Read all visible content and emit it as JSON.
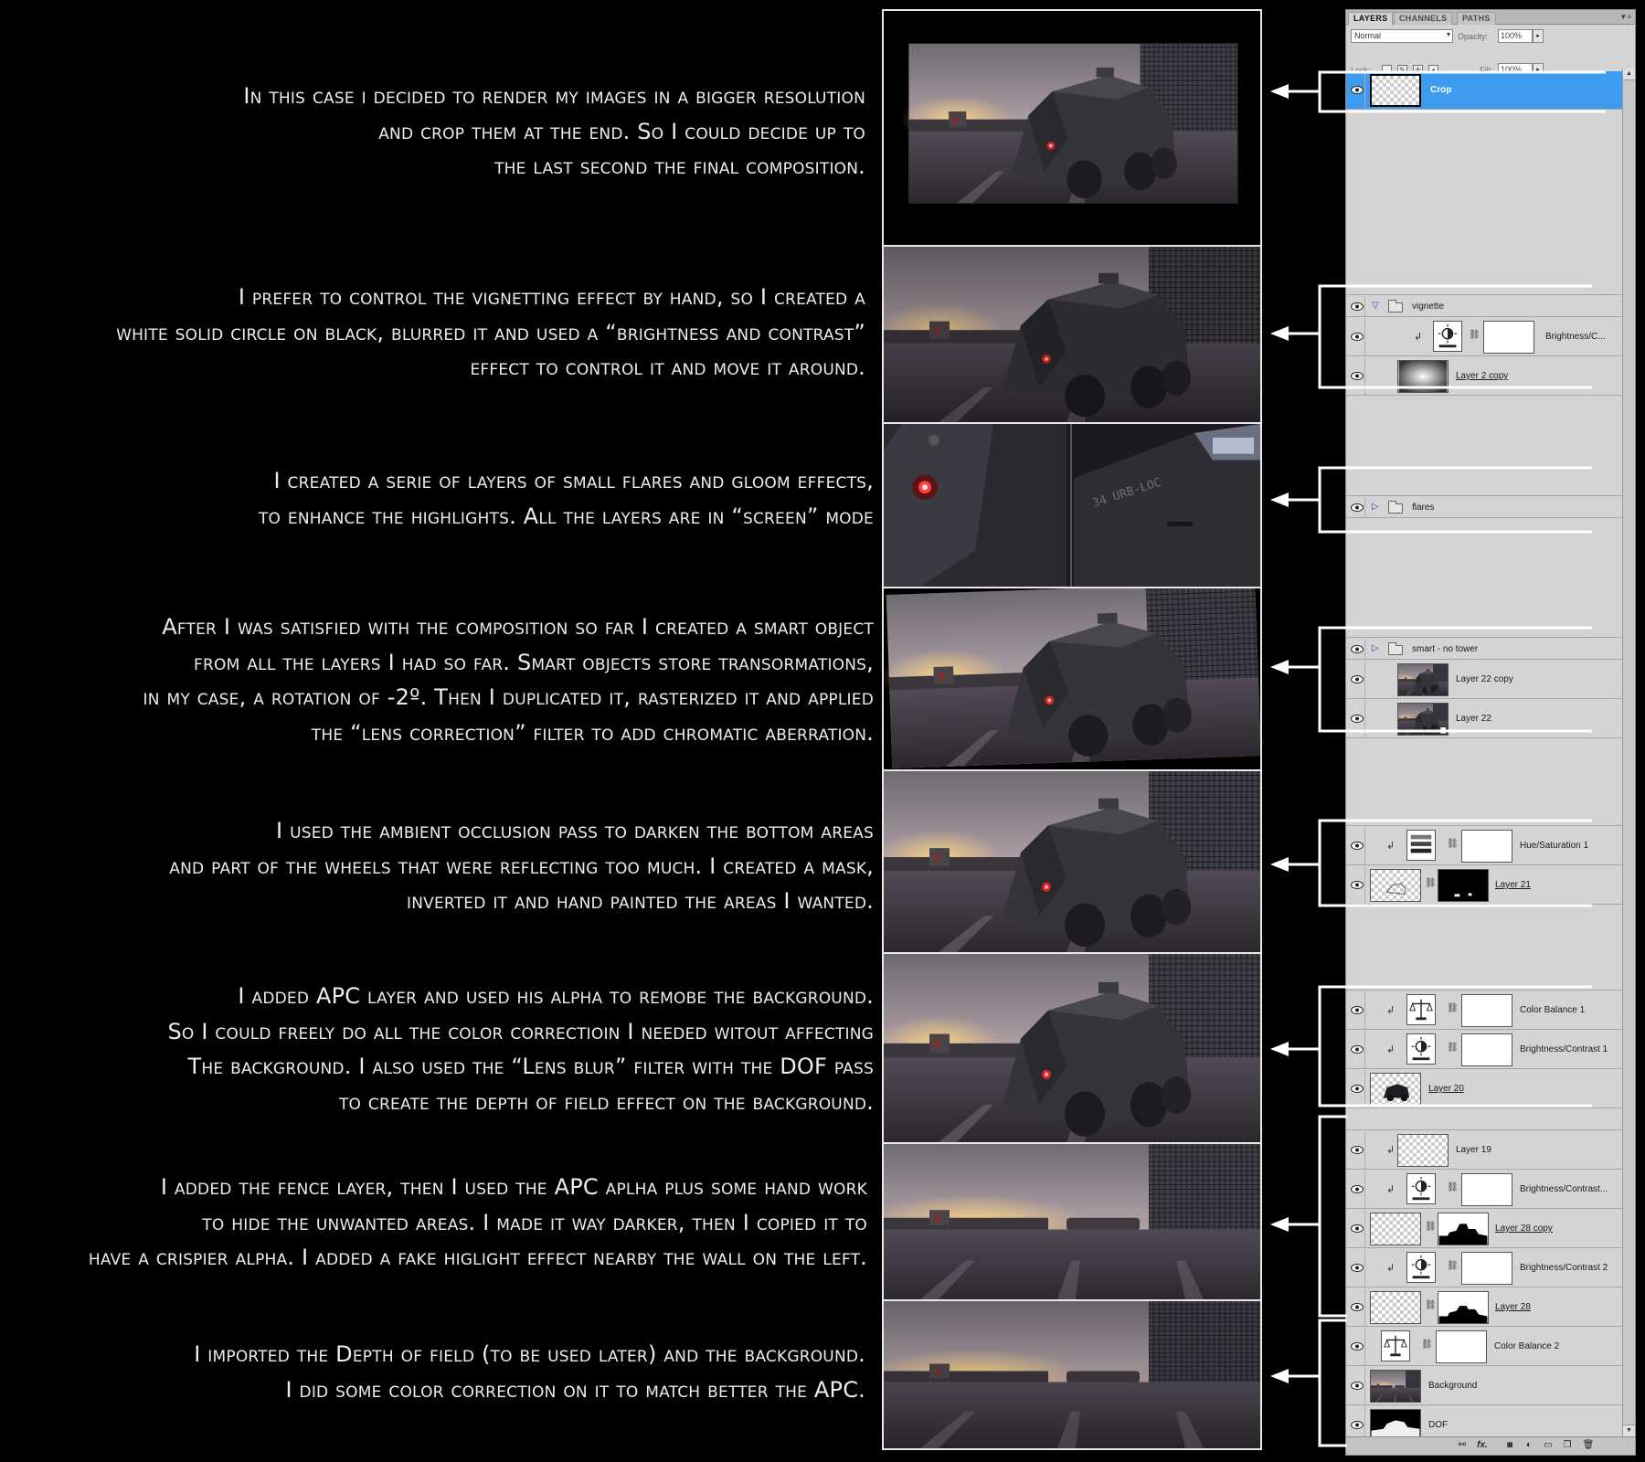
{
  "captions": [
    {
      "lines": [
        "In this case i decided to render my images in a bigger resolution",
        "and crop them at the end. So I could decide up to",
        "the last second the final composition."
      ]
    },
    {
      "lines": [
        "I prefer to control the vignetting effect by hand, so I created a",
        "white solid circle on black, blurred it and used a “brightness and contrast”",
        "effect to control it and move it around."
      ]
    },
    {
      "lines": [
        "I created a serie of layers of small flares and gloom effects,",
        "to enhance the highlights. All the layers are in “screen” mode"
      ]
    },
    {
      "lines": [
        "After I was satisfied with the composition so far I created a smart object",
        "from all the layers I had so far. Smart objects store transormations,",
        "in my case, a rotation of -2º. Then I duplicated it, rasterized it and applied",
        "the “lens correction”  filter to add chromatic aberration."
      ]
    },
    {
      "lines": [
        "I used the ambient occlusion pass to darken the bottom areas",
        "and part of the wheels that were reflecting too much. I created a mask,",
        "inverted it and hand painted the areas I wanted."
      ]
    },
    {
      "lines": [
        "I added APC layer and used his alpha to remobe the background.",
        "So I could freely do all the color correctioin I needed witout affecting",
        "The background. I also used the “Lens blur” filter with the DOF pass",
        "to create the depth of field effect on the background."
      ]
    },
    {
      "lines": [
        "I added the fence layer, then I used the APC aplha plus some hand work",
        "to hide the unwanted areas. I made it way darker, then I copied it to",
        "have a crispier alpha. I added a fake higlight effect nearby the wall on the left."
      ]
    },
    {
      "lines": [
        "I imported the Depth of field (to be used later) and the background.",
        "I did some color correction on it to match better the APC."
      ]
    }
  ],
  "panel": {
    "tabs": [
      "LAYERS",
      "CHANNELS",
      "PATHS"
    ],
    "blend_mode": "Normal",
    "opacity_label": "Opacity:",
    "opacity_value": "100%",
    "lock_label": "Lock:",
    "fill_label": "Fill:",
    "fill_value": "100%",
    "layers": [
      {
        "id": "crop",
        "name": "Crop"
      },
      {
        "id": "vignette",
        "name": "vignette"
      },
      {
        "id": "bc-vignette",
        "name": "Brightness/C..."
      },
      {
        "id": "layer2copy",
        "name": "Layer 2 copy"
      },
      {
        "id": "flares",
        "name": "flares"
      },
      {
        "id": "smart",
        "name": "smart - no tower"
      },
      {
        "id": "layer22copy",
        "name": "Layer 22 copy"
      },
      {
        "id": "layer22",
        "name": "Layer 22"
      },
      {
        "id": "huesat1",
        "name": "Hue/Saturation 1"
      },
      {
        "id": "layer21",
        "name": "Layer 21"
      },
      {
        "id": "colorbal1",
        "name": "Color Balance 1"
      },
      {
        "id": "bc1",
        "name": "Brightness/Contrast 1"
      },
      {
        "id": "layer20",
        "name": "Layer 20"
      },
      {
        "id": "layer19",
        "name": "Layer 19"
      },
      {
        "id": "bc-dots",
        "name": "Brightness/Contrast..."
      },
      {
        "id": "layer28copy",
        "name": "Layer 28 copy"
      },
      {
        "id": "bc2",
        "name": "Brightness/Contrast 2"
      },
      {
        "id": "layer28",
        "name": "Layer 28"
      },
      {
        "id": "colorbal2",
        "name": "Color Balance 2"
      },
      {
        "id": "background",
        "name": "Background"
      },
      {
        "id": "dof",
        "name": "DOF"
      }
    ]
  },
  "icons": [
    "eye-icon",
    "folder-icon",
    "brightness-contrast-icon",
    "color-balance-icon",
    "hue-saturation-icon",
    "chain-link-icon",
    "clipping-arrow-icon",
    "link-layers-icon",
    "fx-icon",
    "add-mask-icon",
    "new-adjustment-icon",
    "new-group-icon",
    "new-layer-icon",
    "trash-icon"
  ],
  "colors": {
    "selection": "#3d9bf0",
    "panel_bg": "#d4d4d4",
    "page_bg": "#000000",
    "caption_text": "#ececec"
  }
}
